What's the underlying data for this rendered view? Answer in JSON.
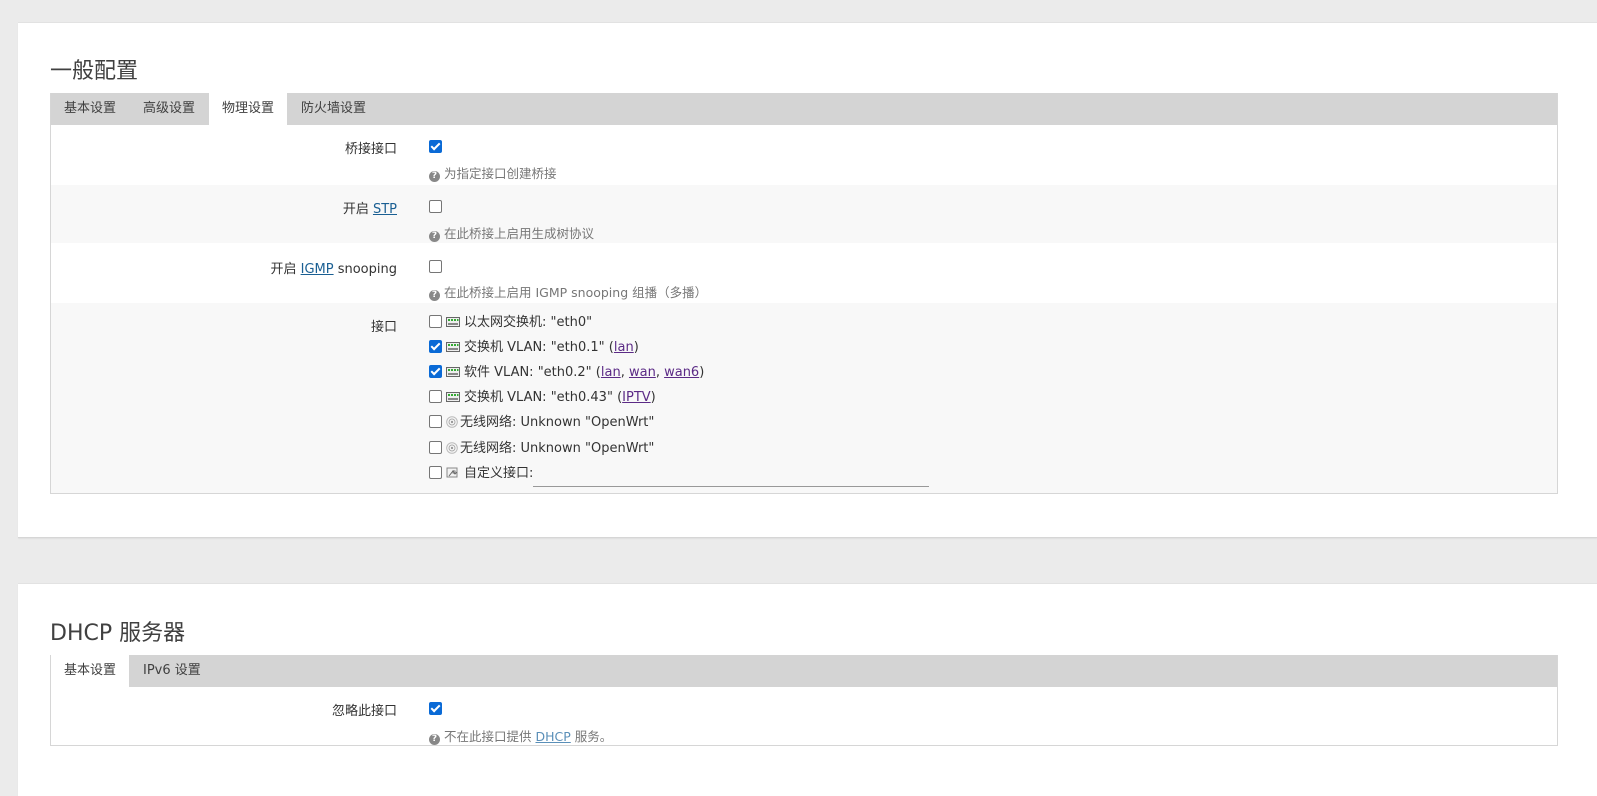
{
  "general": {
    "title": "一般配置",
    "tabs": [
      "基本设置",
      "高级设置",
      "物理设置",
      "防火墙设置"
    ],
    "active_tab": "物理设置",
    "bridge": {
      "label": "桥接接口",
      "checked": true,
      "hint": "为指定接口创建桥接"
    },
    "stp": {
      "label_prefix": "开启 ",
      "label_link": "STP",
      "checked": false,
      "hint": "在此桥接上启用生成树协议"
    },
    "igmp": {
      "label_prefix": "开启 ",
      "label_link": "IGMP",
      "label_suffix": " snooping",
      "checked": false,
      "hint": "在此桥接上启用 IGMP snooping 组播（多播）"
    },
    "interfaces": {
      "label": "接口",
      "items": [
        {
          "checked": false,
          "icon": "ethernet-switch-icon",
          "text": "以太网交换机: \"eth0\"",
          "links": []
        },
        {
          "checked": true,
          "icon": "ethernet-switch-icon",
          "text": "交换机 VLAN: \"eth0.1\"",
          "links": [
            "lan"
          ]
        },
        {
          "checked": true,
          "icon": "ethernet-switch-icon",
          "text": "软件 VLAN: \"eth0.2\"",
          "links": [
            "lan",
            "wan",
            "wan6"
          ]
        },
        {
          "checked": false,
          "icon": "ethernet-switch-icon",
          "text": "交换机 VLAN: \"eth0.43\"",
          "links": [
            "IPTV"
          ]
        },
        {
          "checked": false,
          "icon": "wifi-icon",
          "text": "无线网络: Unknown \"OpenWrt\"",
          "links": []
        },
        {
          "checked": false,
          "icon": "wifi-icon",
          "text": "无线网络: Unknown \"OpenWrt\"",
          "links": []
        },
        {
          "checked": false,
          "icon": "custom-interface-icon",
          "text": "自定义接口:",
          "input_value": ""
        }
      ]
    }
  },
  "dhcp": {
    "title": "DHCP 服务器",
    "tabs": [
      "基本设置",
      "IPv6 设置"
    ],
    "active_tab": "基本设置",
    "ignore": {
      "label": "忽略此接口",
      "checked": true,
      "hint_prefix": "不在此接口提供 ",
      "hint_link": "DHCP",
      "hint_suffix": " 服务。"
    }
  },
  "colors": {
    "accent": "#0a6ad6",
    "link": "#1a5f93",
    "link_visited": "#5b2a86",
    "tabbar": "#d4d4d4",
    "page_bg": "#ebebeb"
  }
}
